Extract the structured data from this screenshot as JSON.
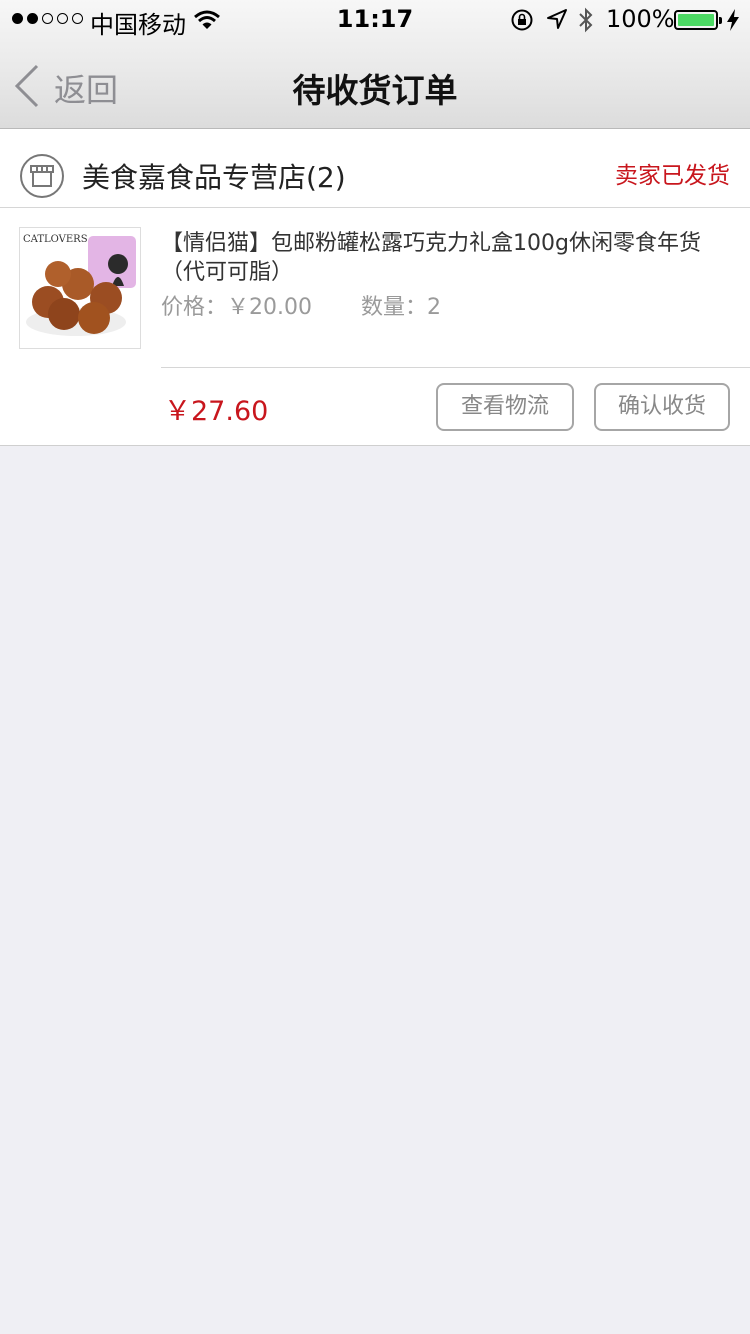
{
  "status_bar": {
    "carrier": "中国移动",
    "time": "11:17",
    "battery": "100%",
    "signal_bars": 2
  },
  "nav": {
    "back_label": "返回",
    "title": "待收货订单"
  },
  "order": {
    "store_name": "美食嘉食品专营店(2)",
    "status": "卖家已发货",
    "product": {
      "thumb_brand": "CATLOVERS",
      "title": "【情侣猫】包邮粉罐松露巧克力礼盒100g休闲零食年货（代可可脂）",
      "price": "价格：￥20.00",
      "quantity": "数量：2"
    },
    "total": "￥27.60",
    "actions": {
      "logistics": "查看物流",
      "confirm": "确认收货"
    }
  },
  "colors": {
    "accent_red": "#c8161d",
    "background": "#efeff4",
    "battery_green": "#4cd964"
  }
}
